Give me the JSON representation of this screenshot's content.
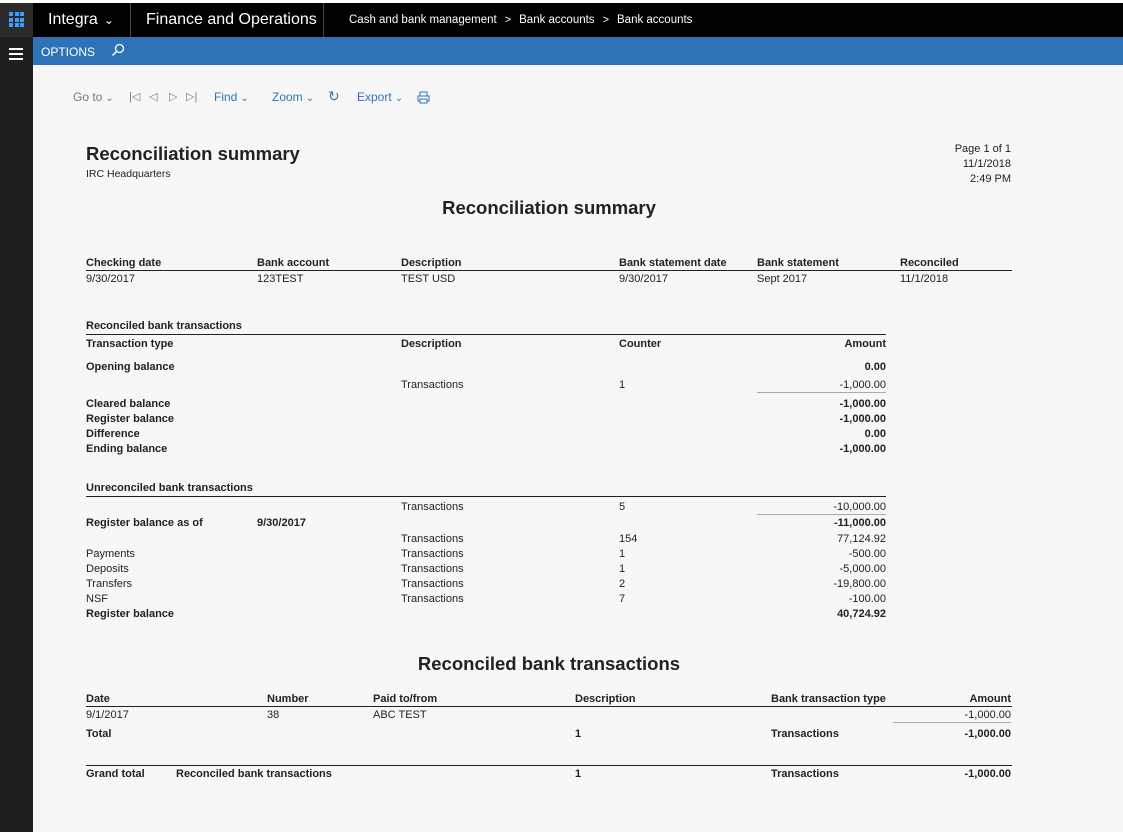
{
  "topbar": {
    "company": "Integra",
    "app_name": "Finance and Operations",
    "breadcrumbs": [
      "Cash and bank management",
      "Bank accounts",
      "Bank accounts"
    ]
  },
  "options_bar": {
    "label": "OPTIONS"
  },
  "toolbar": {
    "goto": "Go to",
    "find": "Find",
    "zoom": "Zoom",
    "export": "Export"
  },
  "report": {
    "title": "Reconciliation summary",
    "company": "IRC Headquarters",
    "page": "Page 1 of 1",
    "date": "11/1/2018",
    "time": "2:49 PM",
    "center_title": "Reconciliation summary",
    "header": {
      "columns": [
        "Checking date",
        "Bank account",
        "Description",
        "Bank statement date",
        "Bank statement",
        "Reconciled"
      ],
      "values": [
        "9/30/2017",
        "123TEST",
        "TEST USD",
        "9/30/2017",
        "Sept 2017",
        "11/1/2018"
      ]
    },
    "reconciled_section": {
      "title": "Reconciled bank transactions",
      "columns": [
        "Transaction type",
        "Description",
        "Counter",
        "Amount"
      ],
      "opening_balance": {
        "label": "Opening balance",
        "amount": "0.00"
      },
      "transactions_row": {
        "description": "Transactions",
        "counter": "1",
        "amount": "-1,000.00"
      },
      "cleared_balance": {
        "label": "Cleared balance",
        "amount": "-1,000.00"
      },
      "register_balance": {
        "label": "Register balance",
        "amount": "-1,000.00"
      },
      "difference": {
        "label": "Difference",
        "amount": "0.00"
      },
      "ending_balance": {
        "label": "Ending balance",
        "amount": "-1,000.00"
      }
    },
    "unreconciled_section": {
      "title": "Unreconciled bank transactions",
      "transactions_row": {
        "description": "Transactions",
        "counter": "5",
        "amount": "-10,000.00"
      },
      "register_balance_as_of": {
        "label": "Register balance as of",
        "date": "9/30/2017",
        "amount": "-11,000.00"
      },
      "rows": [
        {
          "label": "",
          "description": "Transactions",
          "counter": "154",
          "amount": "77,124.92"
        },
        {
          "label": "Payments",
          "description": "Transactions",
          "counter": "1",
          "amount": "-500.00"
        },
        {
          "label": "Deposits",
          "description": "Transactions",
          "counter": "1",
          "amount": "-5,000.00"
        },
        {
          "label": "Transfers",
          "description": "Transactions",
          "counter": "2",
          "amount": "-19,800.00"
        },
        {
          "label": "NSF",
          "description": "Transactions",
          "counter": "7",
          "amount": "-100.00"
        }
      ],
      "register_balance": {
        "label": "Register balance",
        "amount": "40,724.92"
      }
    },
    "detail_section": {
      "title": "Reconciled bank transactions",
      "columns": [
        "Date",
        "Number",
        "Paid to/from",
        "Description",
        "Bank transaction type",
        "Amount"
      ],
      "row": {
        "date": "9/1/2017",
        "number": "38",
        "paid": "ABC TEST",
        "amount": "-1,000.00"
      },
      "total": {
        "label": "Total",
        "count": "1",
        "type": "Transactions",
        "amount": "-1,000.00"
      },
      "grand_total": {
        "label": "Grand total",
        "sublabel": "Reconciled bank transactions",
        "count": "1",
        "type": "Transactions",
        "amount": "-1,000.00"
      }
    }
  },
  "colors": {
    "accent": "#2f73b7",
    "topbar": "#000000",
    "rail": "#1f1f1f",
    "waffle": "#39a0ff"
  }
}
